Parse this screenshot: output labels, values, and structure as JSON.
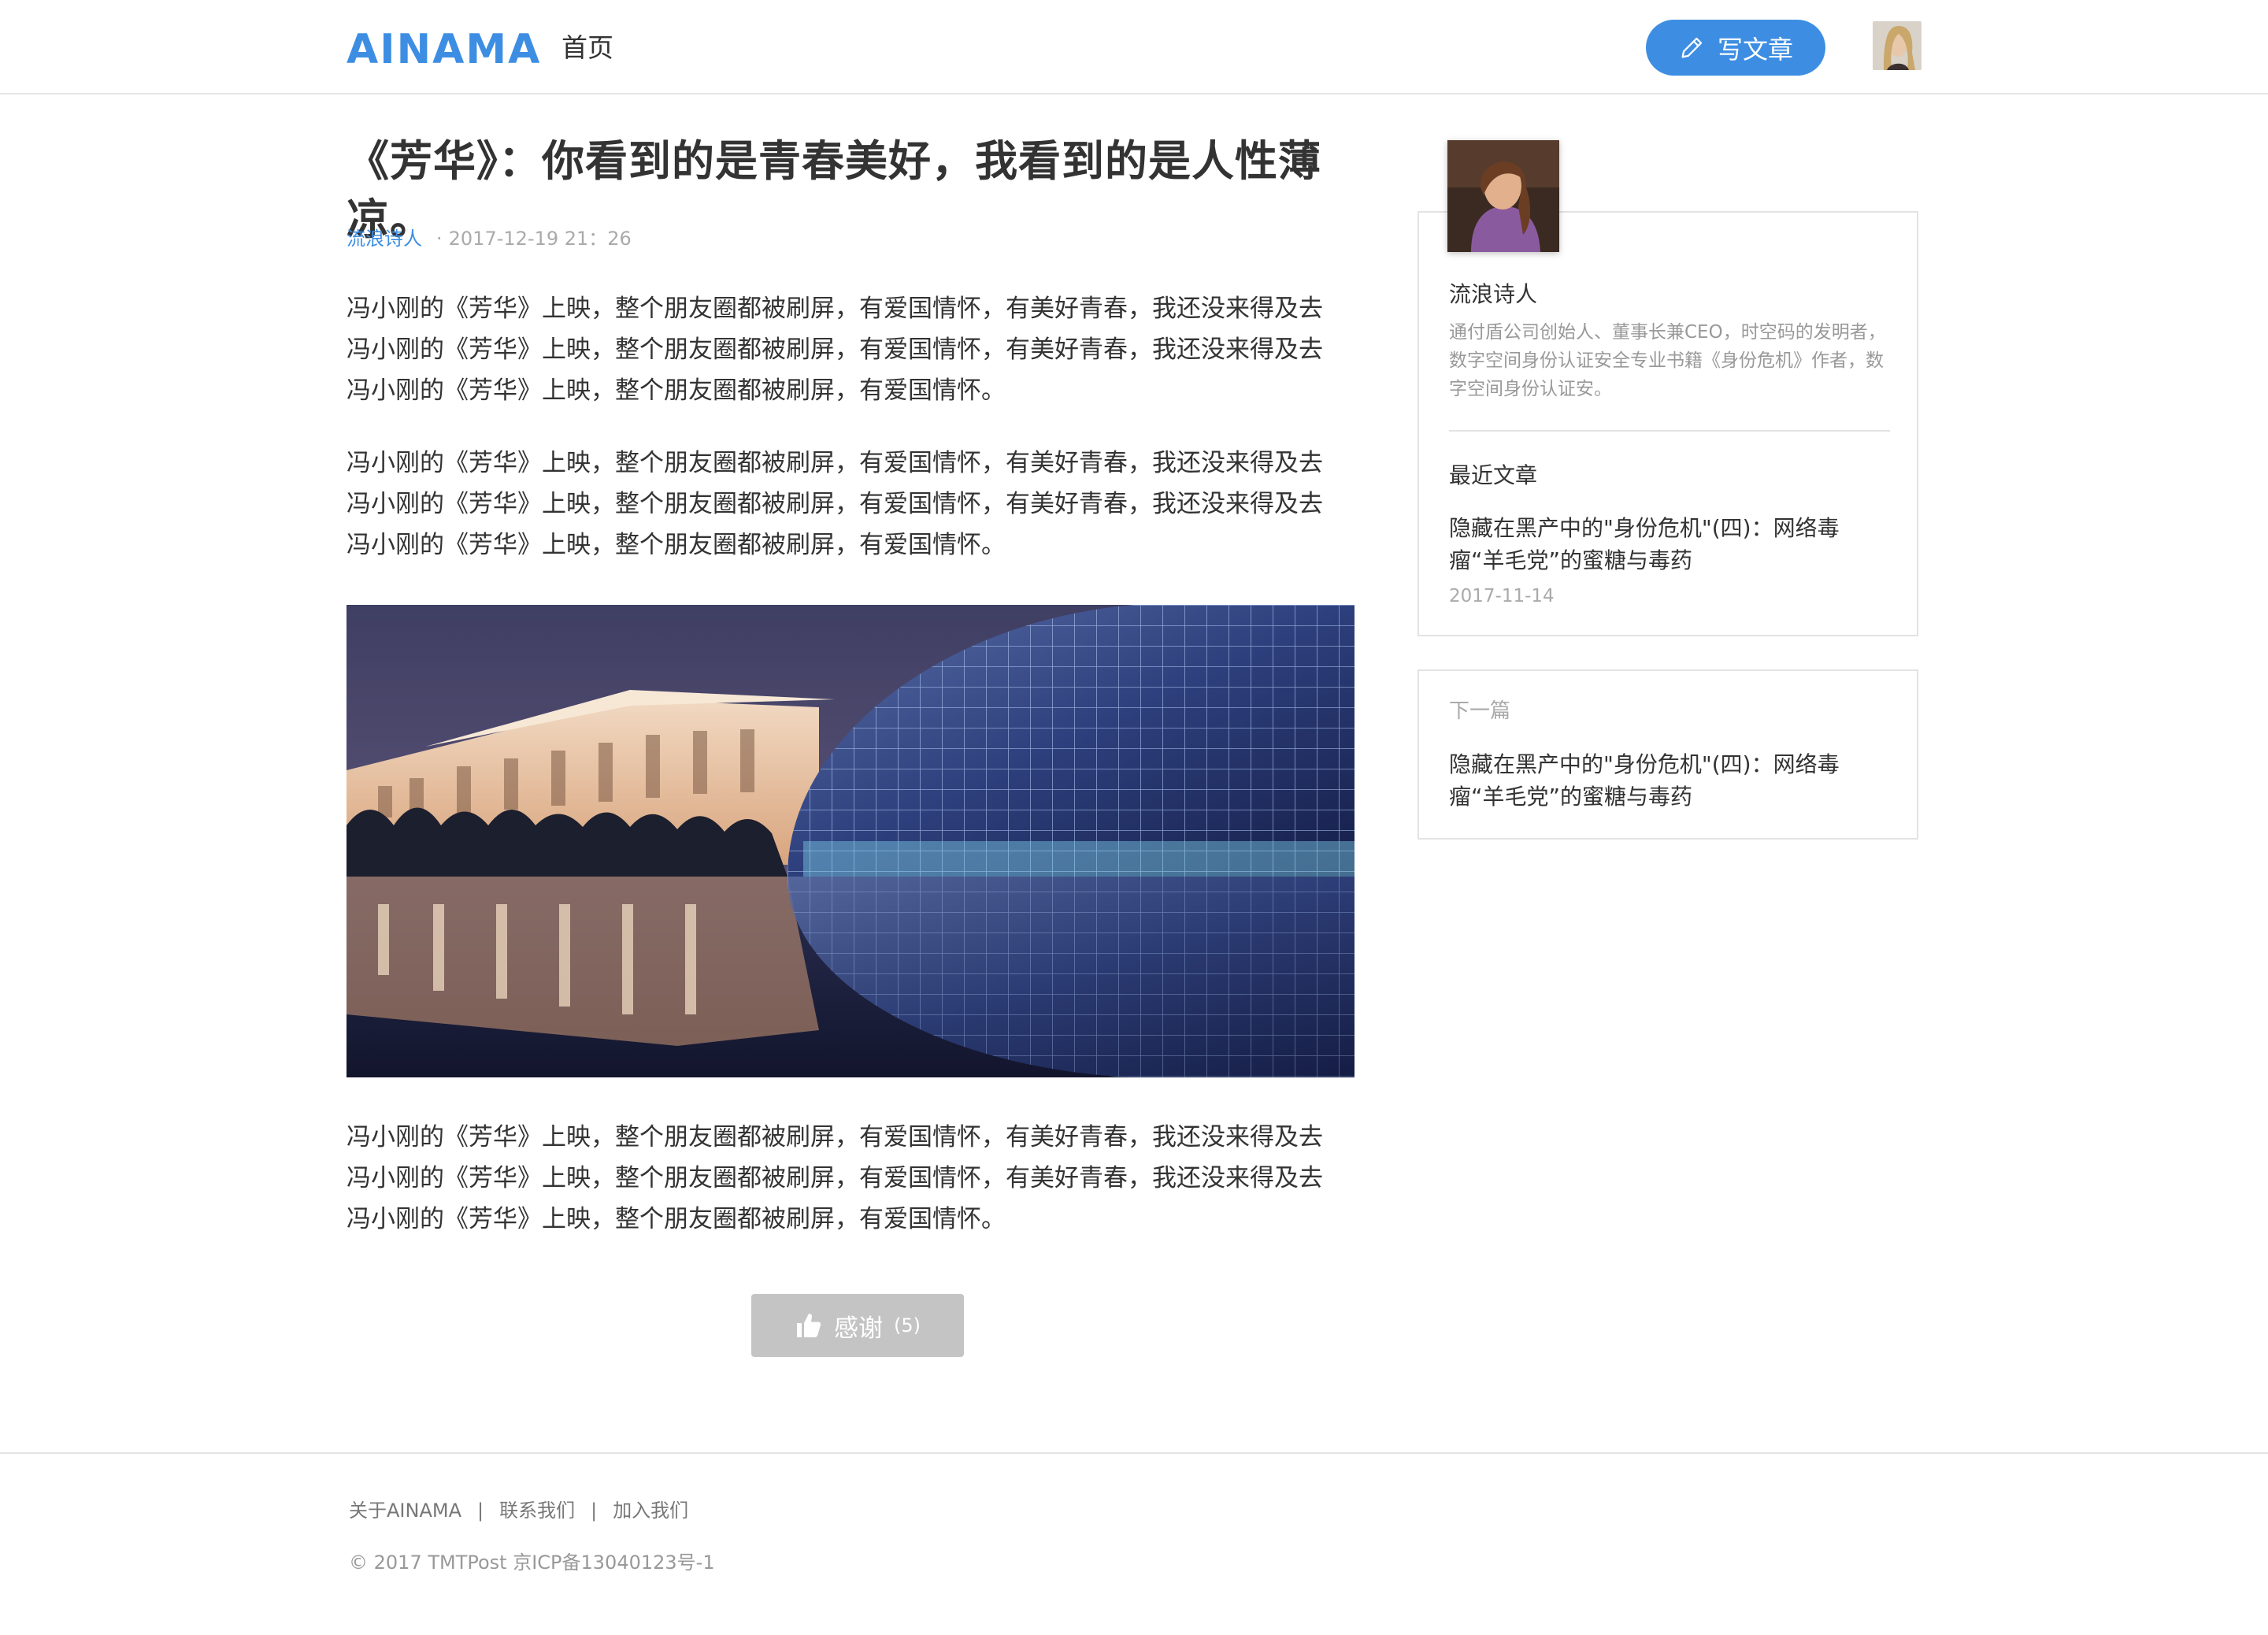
{
  "header": {
    "logo": "AINAMA",
    "nav_home": "首页",
    "write_button": "写文章"
  },
  "article": {
    "title": "《芳华》：你看到的是青春美好，我看到的是人性薄凉。",
    "author": "流浪诗人",
    "dot": "·",
    "date": "2017-12-19  21：26",
    "paragraphs": [
      {
        "lines": [
          "冯小刚的《芳华》上映，整个朋友圈都被刷屏，有爱国情怀，有美好青春，我还没来得及去",
          "冯小刚的《芳华》上映，整个朋友圈都被刷屏，有爱国情怀，有美好青春，我还没来得及去",
          "冯小刚的《芳华》上映，整个朋友圈都被刷屏，有爱国情怀。"
        ]
      },
      {
        "lines": [
          "冯小刚的《芳华》上映，整个朋友圈都被刷屏，有爱国情怀，有美好青春，我还没来得及去",
          "冯小刚的《芳华》上映，整个朋友圈都被刷屏，有爱国情怀，有美好青春，我还没来得及去",
          "冯小刚的《芳华》上映，整个朋友圈都被刷屏，有爱国情怀。"
        ]
      },
      {
        "lines": [
          "冯小刚的《芳华》上映，整个朋友圈都被刷屏，有爱国情怀，有美好青春，我还没来得及去",
          "冯小刚的《芳华》上映，整个朋友圈都被刷屏，有爱国情怀，有美好青春，我还没来得及去",
          "冯小刚的《芳华》上映，整个朋友圈都被刷屏，有爱国情怀。"
        ]
      }
    ],
    "thanks_label": "感谢",
    "thanks_count": "(5)"
  },
  "sidebar": {
    "author_name": "流浪诗人",
    "author_bio": "通付盾公司创始人、董事长兼CEO，时空码的发明者，数字空间身份认证安全专业书籍《身份危机》作者，数字空间身份认证安。",
    "recent_heading": "最近文章",
    "recent_title": "隐藏在黑产中的\"身份危机\"(四)：网络毒瘤“羊毛党”的蜜糖与毒药",
    "recent_date": "2017-11-14",
    "next_label": "下一篇",
    "next_title": "隐藏在黑产中的\"身份危机\"(四)：网络毒瘤“羊毛党”的蜜糖与毒药"
  },
  "footer": {
    "links": [
      "关于AINAMA",
      "联系我们",
      "加入我们"
    ],
    "separator": "|",
    "copyright": "© 2017 TMTPost 京ICP备13040123号-1"
  },
  "colors": {
    "accent": "#3d8ee3",
    "thanks_button": "#c4c4c4",
    "border": "#e3e3e3"
  },
  "icons": [
    "pen-icon",
    "thumbs-up-icon"
  ]
}
